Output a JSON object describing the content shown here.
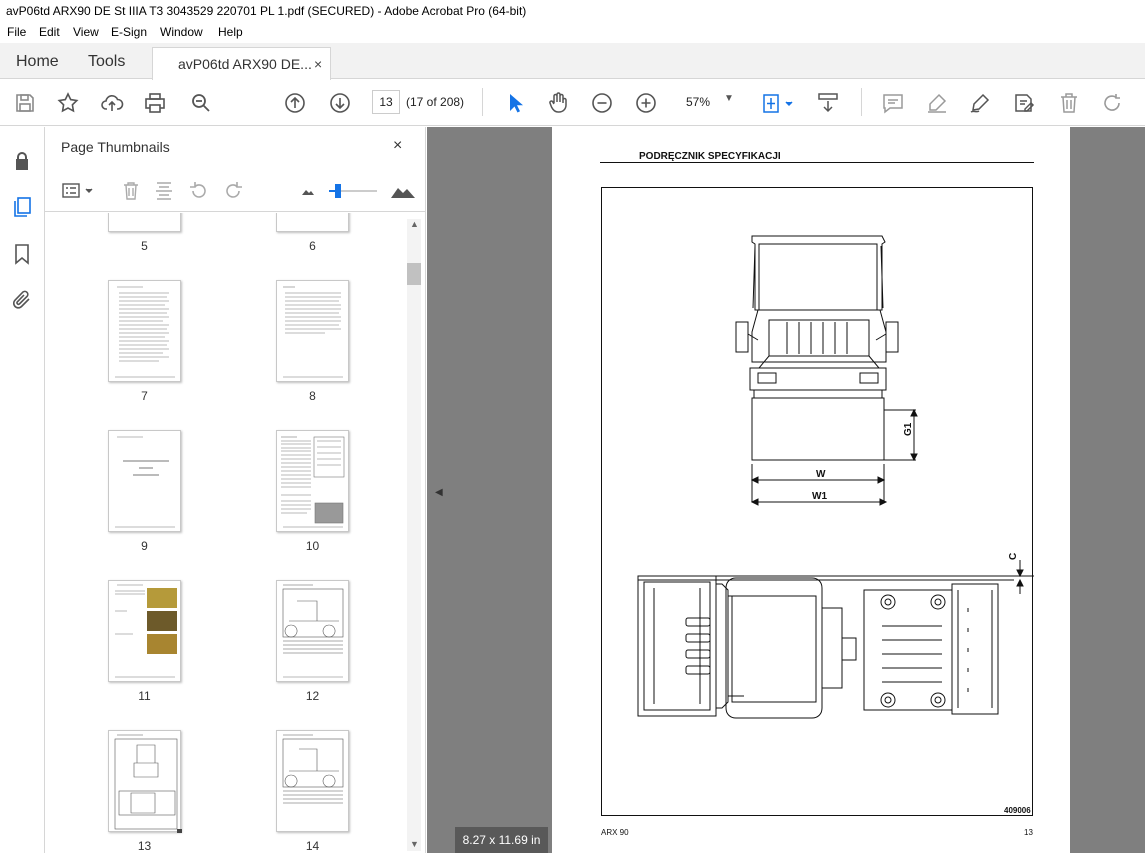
{
  "window": {
    "title": "avP06td ARX90 DE St IIIA T3 3043529 220701 PL 1.pdf (SECURED) - Adobe Acrobat Pro (64-bit)"
  },
  "menu": [
    "File",
    "Edit",
    "View",
    "E-Sign",
    "Window",
    "Help"
  ],
  "tabs": {
    "home": "Home",
    "tools": "Tools",
    "document": "avP06td ARX90 DE...",
    "close": "×"
  },
  "toolbar": {
    "page_number": "13",
    "page_count": "(17 of 208)",
    "zoom": "57%",
    "zoom_dropdown": "▼"
  },
  "thumbnails_panel": {
    "title": "Page Thumbnails",
    "close": "×",
    "pages": [
      "5",
      "6",
      "7",
      "8",
      "9",
      "10",
      "11",
      "12",
      "13",
      "14"
    ],
    "selected_page": "13"
  },
  "document": {
    "header": "PODRĘCZNIK SPECYFIKACJI",
    "dimension_labels": [
      "W",
      "W1",
      "G1",
      "C"
    ],
    "figure_code": "409006",
    "footer_left": "ARX 90",
    "footer_page": "13",
    "page_size": "8.27 x 11.69 in"
  },
  "colors": {
    "accent": "#1473e6",
    "viewer_background": "#7f7f7f",
    "icon": "#6b6b6b"
  }
}
